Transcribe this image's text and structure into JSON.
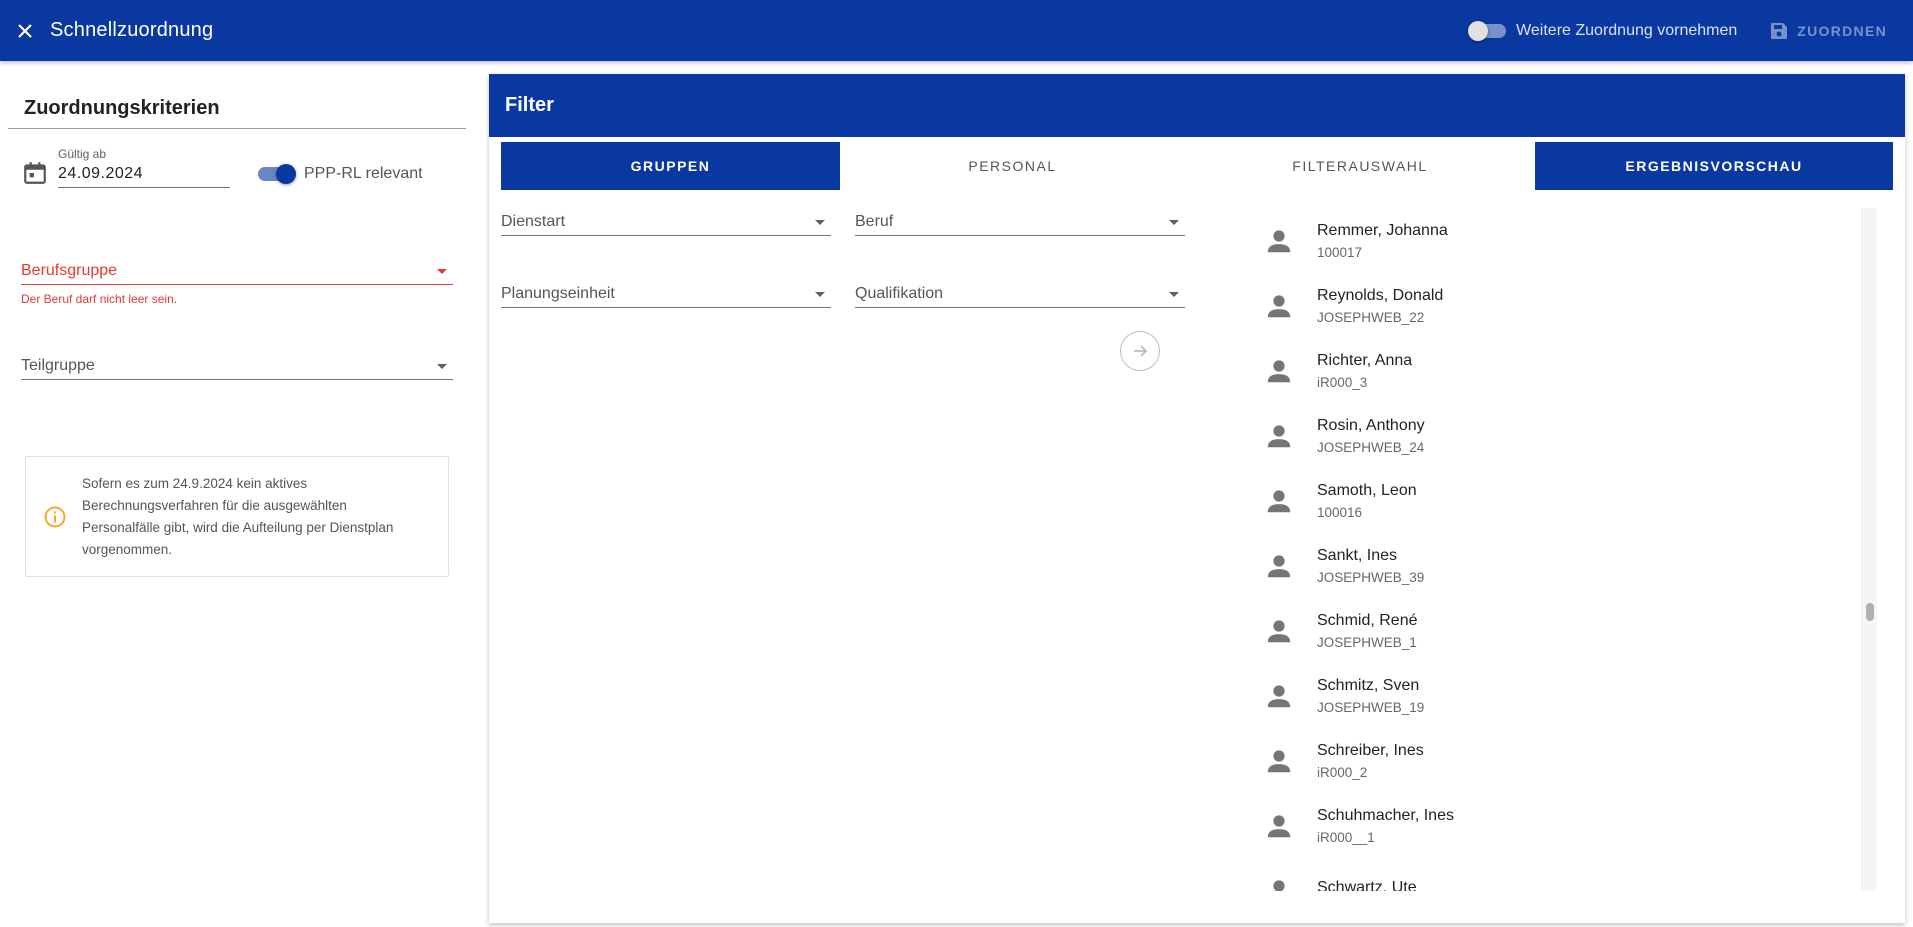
{
  "appbar": {
    "title": "Schnellzuordnung",
    "toggle_label": "Weitere Zuordnung vornehmen",
    "save_label": "ZUORDNEN",
    "bg_color": "#0a38a1"
  },
  "criteria": {
    "heading": "Zuordnungskriterien",
    "date_label": "Gültig ab",
    "date_value": "24.09.2024",
    "ppp_label": "PPP-RL relevant",
    "berufsgruppe_label": "Berufsgruppe",
    "berufsgruppe_error": "Der Beruf darf nicht leer sein.",
    "teilgruppe_label": "Teilgruppe",
    "info_text": "Sofern es zum 24.9.2024 kein aktives Berechnungsverfahren für die ausgewählten Personalfälle gibt, wird die Aufteilung per Dienstplan vorgenommen."
  },
  "filter": {
    "title": "Filter",
    "tabs": [
      {
        "label": "GRUPPEN"
      },
      {
        "label": "PERSONAL"
      },
      {
        "label": "FILTERAUSWAHL"
      },
      {
        "label": "ERGEBNISVORSCHAU"
      }
    ],
    "fields": {
      "dienstart": "Dienstart",
      "beruf": "Beruf",
      "planungseinheit": "Planungseinheit",
      "qualifikation": "Qualifikation"
    },
    "results": [
      {
        "name": "Remmer, Johanna",
        "id": "100017"
      },
      {
        "name": "Reynolds, Donald",
        "id": "JOSEPHWEB_22"
      },
      {
        "name": "Richter, Anna",
        "id": "iR000_3"
      },
      {
        "name": "Rosin, Anthony",
        "id": "JOSEPHWEB_24"
      },
      {
        "name": "Samoth, Leon",
        "id": "100016"
      },
      {
        "name": "Sankt, Ines",
        "id": "JOSEPHWEB_39"
      },
      {
        "name": "Schmid, René",
        "id": "JOSEPHWEB_1"
      },
      {
        "name": "Schmitz, Sven",
        "id": "JOSEPHWEB_19"
      },
      {
        "name": "Schreiber, Ines",
        "id": "iR000_2"
      },
      {
        "name": "Schuhmacher, Ines",
        "id": "iR000__1"
      },
      {
        "name": "Schwartz, Ute",
        "id": ""
      }
    ]
  }
}
